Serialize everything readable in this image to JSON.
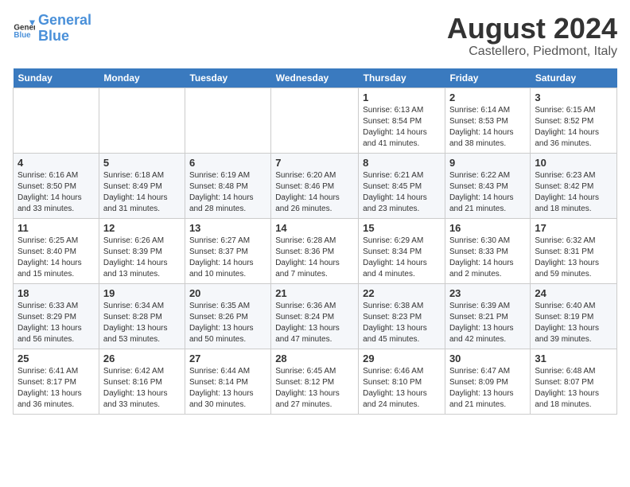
{
  "header": {
    "logo_line1": "General",
    "logo_line2": "Blue",
    "main_title": "August 2024",
    "subtitle": "Castellero, Piedmont, Italy"
  },
  "days_of_week": [
    "Sunday",
    "Monday",
    "Tuesday",
    "Wednesday",
    "Thursday",
    "Friday",
    "Saturday"
  ],
  "weeks": [
    [
      {
        "day": "",
        "info": ""
      },
      {
        "day": "",
        "info": ""
      },
      {
        "day": "",
        "info": ""
      },
      {
        "day": "",
        "info": ""
      },
      {
        "day": "1",
        "info": "Sunrise: 6:13 AM\nSunset: 8:54 PM\nDaylight: 14 hours and 41 minutes."
      },
      {
        "day": "2",
        "info": "Sunrise: 6:14 AM\nSunset: 8:53 PM\nDaylight: 14 hours and 38 minutes."
      },
      {
        "day": "3",
        "info": "Sunrise: 6:15 AM\nSunset: 8:52 PM\nDaylight: 14 hours and 36 minutes."
      }
    ],
    [
      {
        "day": "4",
        "info": "Sunrise: 6:16 AM\nSunset: 8:50 PM\nDaylight: 14 hours and 33 minutes."
      },
      {
        "day": "5",
        "info": "Sunrise: 6:18 AM\nSunset: 8:49 PM\nDaylight: 14 hours and 31 minutes."
      },
      {
        "day": "6",
        "info": "Sunrise: 6:19 AM\nSunset: 8:48 PM\nDaylight: 14 hours and 28 minutes."
      },
      {
        "day": "7",
        "info": "Sunrise: 6:20 AM\nSunset: 8:46 PM\nDaylight: 14 hours and 26 minutes."
      },
      {
        "day": "8",
        "info": "Sunrise: 6:21 AM\nSunset: 8:45 PM\nDaylight: 14 hours and 23 minutes."
      },
      {
        "day": "9",
        "info": "Sunrise: 6:22 AM\nSunset: 8:43 PM\nDaylight: 14 hours and 21 minutes."
      },
      {
        "day": "10",
        "info": "Sunrise: 6:23 AM\nSunset: 8:42 PM\nDaylight: 14 hours and 18 minutes."
      }
    ],
    [
      {
        "day": "11",
        "info": "Sunrise: 6:25 AM\nSunset: 8:40 PM\nDaylight: 14 hours and 15 minutes."
      },
      {
        "day": "12",
        "info": "Sunrise: 6:26 AM\nSunset: 8:39 PM\nDaylight: 14 hours and 13 minutes."
      },
      {
        "day": "13",
        "info": "Sunrise: 6:27 AM\nSunset: 8:37 PM\nDaylight: 14 hours and 10 minutes."
      },
      {
        "day": "14",
        "info": "Sunrise: 6:28 AM\nSunset: 8:36 PM\nDaylight: 14 hours and 7 minutes."
      },
      {
        "day": "15",
        "info": "Sunrise: 6:29 AM\nSunset: 8:34 PM\nDaylight: 14 hours and 4 minutes."
      },
      {
        "day": "16",
        "info": "Sunrise: 6:30 AM\nSunset: 8:33 PM\nDaylight: 14 hours and 2 minutes."
      },
      {
        "day": "17",
        "info": "Sunrise: 6:32 AM\nSunset: 8:31 PM\nDaylight: 13 hours and 59 minutes."
      }
    ],
    [
      {
        "day": "18",
        "info": "Sunrise: 6:33 AM\nSunset: 8:29 PM\nDaylight: 13 hours and 56 minutes."
      },
      {
        "day": "19",
        "info": "Sunrise: 6:34 AM\nSunset: 8:28 PM\nDaylight: 13 hours and 53 minutes."
      },
      {
        "day": "20",
        "info": "Sunrise: 6:35 AM\nSunset: 8:26 PM\nDaylight: 13 hours and 50 minutes."
      },
      {
        "day": "21",
        "info": "Sunrise: 6:36 AM\nSunset: 8:24 PM\nDaylight: 13 hours and 47 minutes."
      },
      {
        "day": "22",
        "info": "Sunrise: 6:38 AM\nSunset: 8:23 PM\nDaylight: 13 hours and 45 minutes."
      },
      {
        "day": "23",
        "info": "Sunrise: 6:39 AM\nSunset: 8:21 PM\nDaylight: 13 hours and 42 minutes."
      },
      {
        "day": "24",
        "info": "Sunrise: 6:40 AM\nSunset: 8:19 PM\nDaylight: 13 hours and 39 minutes."
      }
    ],
    [
      {
        "day": "25",
        "info": "Sunrise: 6:41 AM\nSunset: 8:17 PM\nDaylight: 13 hours and 36 minutes."
      },
      {
        "day": "26",
        "info": "Sunrise: 6:42 AM\nSunset: 8:16 PM\nDaylight: 13 hours and 33 minutes."
      },
      {
        "day": "27",
        "info": "Sunrise: 6:44 AM\nSunset: 8:14 PM\nDaylight: 13 hours and 30 minutes."
      },
      {
        "day": "28",
        "info": "Sunrise: 6:45 AM\nSunset: 8:12 PM\nDaylight: 13 hours and 27 minutes."
      },
      {
        "day": "29",
        "info": "Sunrise: 6:46 AM\nSunset: 8:10 PM\nDaylight: 13 hours and 24 minutes."
      },
      {
        "day": "30",
        "info": "Sunrise: 6:47 AM\nSunset: 8:09 PM\nDaylight: 13 hours and 21 minutes."
      },
      {
        "day": "31",
        "info": "Sunrise: 6:48 AM\nSunset: 8:07 PM\nDaylight: 13 hours and 18 minutes."
      }
    ]
  ]
}
